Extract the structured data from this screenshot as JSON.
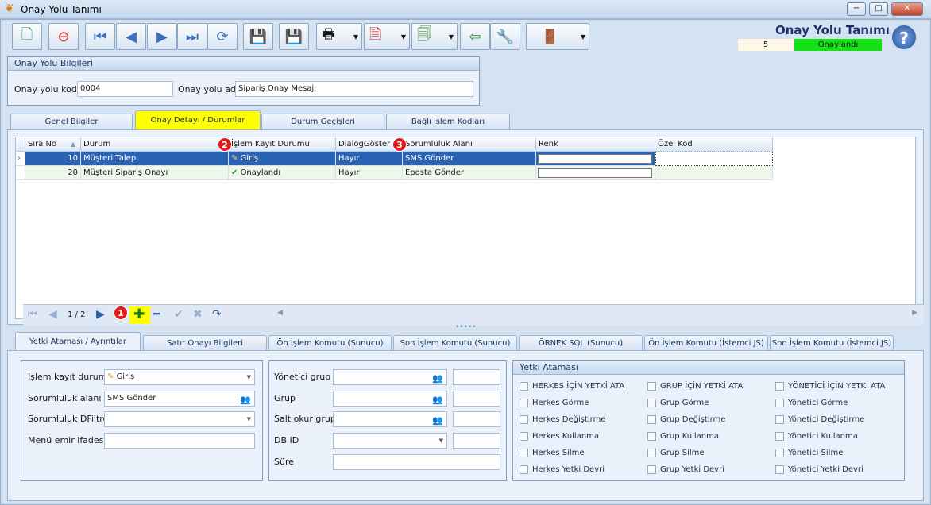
{
  "window": {
    "title": "Onay Yolu Tanımı",
    "min": "−",
    "max": "□",
    "close": "✕"
  },
  "header": {
    "title": "Onay Yolu Tanımı",
    "count": "5",
    "status": "Onaylandı",
    "help": "?"
  },
  "info": {
    "title": "Onay Yolu Bilgileri",
    "code_label": "Onay yolu kodu",
    "code_value": "0004",
    "name_label": "Onay yolu adı",
    "name_value": "Sipariş Onay Mesajı"
  },
  "tabs": [
    "Genel Bilgiler",
    "Onay Detayı / Durumlar",
    "Durum Geçişleri",
    "Bağlı işlem Kodları"
  ],
  "grid": {
    "columns": [
      "Sıra No",
      "Durum",
      "İşlem Kayıt Durumu",
      "DialogGöster",
      "Sorumluluk Alanı",
      "Renk",
      "Özel Kod"
    ],
    "rows": [
      {
        "no": "10",
        "durum": "Müşteri Talep",
        "kayit": "Giriş",
        "dialog": "Hayır",
        "sorum": "SMS Gönder",
        "renk": "",
        "ozel": ""
      },
      {
        "no": "20",
        "durum": "Müşteri Sipariş Onayı",
        "kayit": "Onaylandı",
        "dialog": "Hayır",
        "sorum": "Eposta Gönder",
        "renk": "",
        "ozel": ""
      }
    ],
    "page": "1 / 2"
  },
  "badges": [
    "1",
    "2",
    "3"
  ],
  "bottom_tabs": [
    "Yetki Ataması / Ayrıntılar",
    "Satır Onayı Bilgileri",
    "Ön İşlem Komutu (Sunucu)",
    "Son İşlem Komutu (Sunucu)",
    "ÖRNEK SQL (Sunucu)",
    "Ön İşlem Komutu (İstemci JS)",
    "Son İşlem Komutu (İstemci JS)"
  ],
  "details": {
    "kayit_label": "İşlem kayıt durumu",
    "kayit_value": "Giriş",
    "sorum_label": "Sorumluluk alanı",
    "sorum_value": "SMS Gönder",
    "dfiltre_label": "Sorumluluk DFiltre",
    "dfiltre_value": "",
    "menu_label": "Menü emir ifadesi",
    "menu_value": ""
  },
  "groups": {
    "yonetici_label": "Yönetici grup",
    "grup_label": "Grup",
    "salt_label": "Salt okur grup",
    "dbid_label": "DB ID",
    "sure_label": "Süre"
  },
  "yetki": {
    "title": "Yetki Ataması",
    "col1": [
      "HERKES İÇİN YETKİ ATA",
      "Herkes Görme",
      "Herkes Değiştirme",
      "Herkes Kullanma",
      "Herkes Silme",
      "Herkes Yetki Devri"
    ],
    "col2": [
      "GRUP İÇİN YETKİ ATA",
      "Grup Görme",
      "Grup Değiştirme",
      "Grup Kullanma",
      "Grup Silme",
      "Grup Yetki Devri"
    ],
    "col3": [
      "YÖNETİCİ İÇİN YETKİ ATA",
      "Yönetici Görme",
      "Yönetici Değiştirme",
      "Yönetici Kullanma",
      "Yönetici Silme",
      "Yönetici Yetki Devri"
    ]
  },
  "colors": {
    "accent": "#ffff00",
    "selected_row": "#2b63b4",
    "status": "#16e016"
  }
}
